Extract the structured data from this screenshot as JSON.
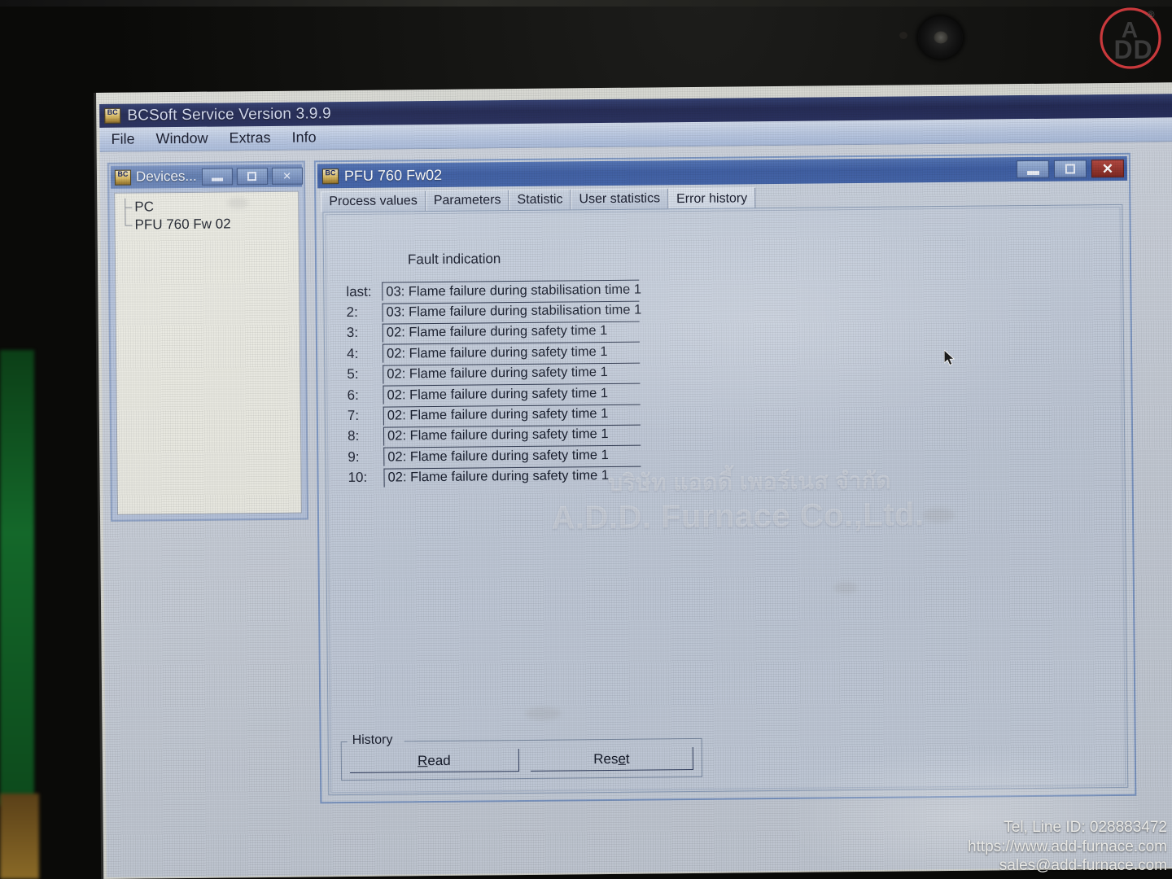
{
  "app": {
    "title": "BCSoft Service Version 3.9.9",
    "icon": "bcsoft-icon",
    "menu": [
      "File",
      "Window",
      "Extras",
      "Info"
    ]
  },
  "devices_window": {
    "title": "Devices...",
    "icon": "bcsoft-icon",
    "buttons": {
      "minimize": "minimize-icon",
      "maximize": "maximize-icon",
      "close": "close-icon"
    },
    "tree": [
      {
        "label": "PC"
      },
      {
        "label": "PFU 760 Fw 02"
      }
    ]
  },
  "pfu_window": {
    "title": "PFU 760 Fw02",
    "icon": "bcsoft-icon",
    "buttons": {
      "minimize": "minimize-icon",
      "maximize": "maximize-icon",
      "close": "close-icon"
    },
    "tabs": [
      {
        "label": "Process values",
        "active": false
      },
      {
        "label": "Parameters",
        "active": false
      },
      {
        "label": "Statistic",
        "active": false
      },
      {
        "label": "User statistics",
        "active": false
      },
      {
        "label": "Error history",
        "active": true
      }
    ],
    "fault_indication_label": "Fault indication",
    "errors": [
      {
        "index": "last:",
        "text": "03: Flame failure during stabilisation time 1"
      },
      {
        "index": "2:",
        "text": "03: Flame failure during stabilisation time 1"
      },
      {
        "index": "3:",
        "text": "02: Flame failure during safety time 1"
      },
      {
        "index": "4:",
        "text": "02: Flame failure during safety time 1"
      },
      {
        "index": "5:",
        "text": "02: Flame failure during safety time 1"
      },
      {
        "index": "6:",
        "text": "02: Flame failure during safety time 1"
      },
      {
        "index": "7:",
        "text": "02: Flame failure during safety time 1"
      },
      {
        "index": "8:",
        "text": "02: Flame failure during safety time 1"
      },
      {
        "index": "9:",
        "text": "02: Flame failure during safety time 1"
      },
      {
        "index": "10:",
        "text": "02: Flame failure during safety time 1"
      }
    ],
    "history_group": {
      "legend": "History",
      "read_button": {
        "prefix": "",
        "accel": "R",
        "suffix": "ead"
      },
      "reset_button": {
        "prefix": "Res",
        "accel": "e",
        "suffix": "t"
      }
    }
  },
  "watermark": {
    "line1": "บริษัท แอดดี้ เพอร์เนส จำกัด",
    "line2": "A.D.D. Furnace Co.,Ltd."
  },
  "overlay": {
    "logo_text": "ADD",
    "logo_mark": "®",
    "contact": [
      "Tel, Line ID: 028883472",
      "https://www.add-furnace.com",
      "sales@add-furnace.com"
    ]
  },
  "colors": {
    "titlebar": "#1d2450",
    "child_titlebar": "#3a5ba2",
    "close_red": "#7d231c",
    "desktop": "#c6cdd8",
    "logo_red": "#c9393c"
  }
}
